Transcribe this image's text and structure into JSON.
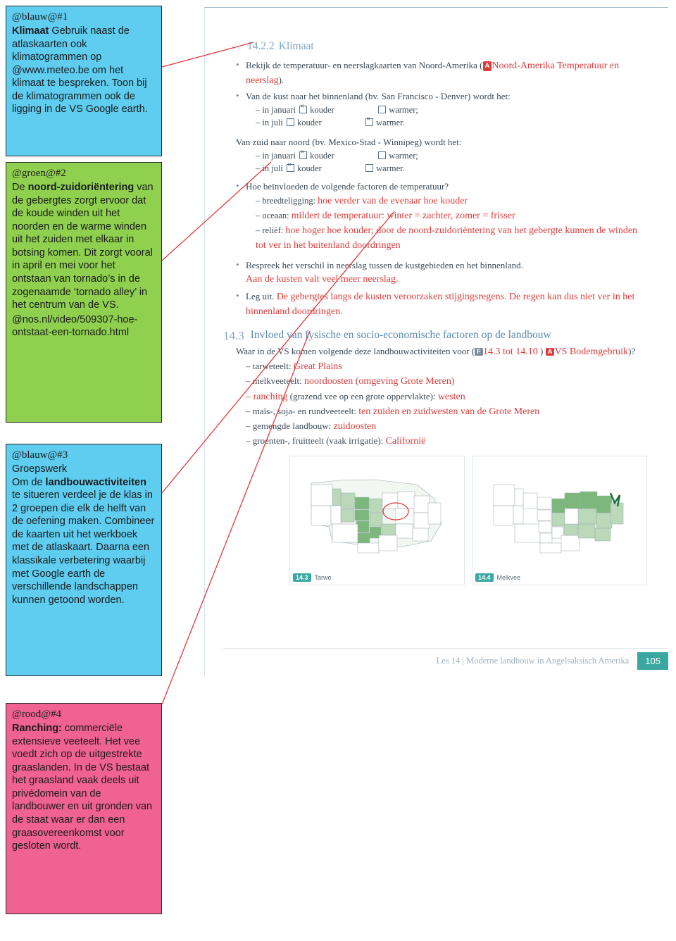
{
  "notes": [
    {
      "id": "note1",
      "tag": "@blauw@#1",
      "color": "#5ecdf0",
      "bold_lead": "Klimaat",
      "text": " Gebruik naast de atlaskaarten ook klimatogrammen op @www.meteo.be om het klimaat te bespreken. Toon bij de klimatogrammen ook de ligging in de VS Google earth."
    },
    {
      "id": "note2",
      "tag": "@groen@#2",
      "color": "#8fd14f",
      "text_before": "De ",
      "bold_lead": "noord-zuidoriëntering",
      "text": " van de gebergtes zorgt ervoor dat de koude winden uit het noorden en de warme winden uit het zuiden met elkaar in botsing komen. Dit zorgt vooral in april en mei voor het ontstaan van tornado’s in de zogenaamde ‘tornado alley’ in het centrum van de VS.",
      "link": "@nos.nl/video/509307-hoe-ontstaat-een-tornado.html"
    },
    {
      "id": "note3",
      "tag": "@blauw@#3",
      "color": "#5ecdf0",
      "title": "Groepswerk",
      "text_before": "Om de ",
      "bold_lead": "landbouwactiviteiten",
      "text": " te situeren verdeel je de klas in 2 groepen die elk de helft van de oefening maken. Combineer de kaarten uit het werkboek met de atlaskaart. Daarna een klassikale verbetering waarbij met Google earth de verschillende landschappen kunnen getoond worden."
    },
    {
      "id": "note4",
      "tag": "@rood@#4",
      "color": "#f06292",
      "bold_lead": "Ranching:",
      "text": " commerciële extensieve veeteelt. Het vee voedt zich op de uitgestrekte graaslanden. In de VS bestaat het graasland vaak deels uit privédomein van de landbouwer en uit gronden van de staat waar er dan een graasovereenkomst voor gesloten wordt."
    }
  ],
  "page": {
    "section_climate": {
      "number": "14.2.2",
      "title": "Klimaat"
    },
    "bullets": [
      {
        "text_before": "Bekijk de temperatuur- en neerslagkaarten van Noord-Amerika (",
        "badge": "A",
        "badge_text": "Noord-Amerika Temperatuur en neerslag",
        "text_after": ")."
      },
      {
        "text": "Van de kust naar het binnenland (bv. San Francisco - Denver) wordt het:",
        "rows": [
          {
            "label": "– in januari",
            "opt1": "kouder",
            "opt1_checked": true,
            "opt2": "warmer;",
            "opt2_checked": false
          },
          {
            "label": "– in juli",
            "opt1": "kouder",
            "opt1_checked": false,
            "opt2": "warmer.",
            "opt2_checked": true
          }
        ]
      },
      {
        "text": "Van zuid naar noord (bv. Mexico-Stad - Winnipeg) wordt het:",
        "rows": [
          {
            "label": "– in januari",
            "opt1": "kouder",
            "opt1_checked": true,
            "opt2": "warmer;",
            "opt2_checked": false
          },
          {
            "label": "– in juli",
            "opt1": "kouder",
            "opt1_checked": true,
            "opt2": "warmer.",
            "opt2_checked": false
          }
        ]
      },
      {
        "text": "Hoe beïnvloeden de volgende factoren de temperatuur?",
        "items": [
          {
            "label": "– breedteligging:",
            "answer": "hoe verder van de evenaar hoe kouder"
          },
          {
            "label": "– oceaan:",
            "answer": "mildert de temperatuur: winter = zachter, zomer = frisser"
          },
          {
            "label": "– reliëf:",
            "answer": "hoe hoger hoe kouder; door de noord-zuidoriëntering van het gebergte kunnen de winden tot ver in het buitenland doordringen"
          }
        ]
      },
      {
        "text": "Bespreek het verschil in neerslag tussen de kustgebieden en het binnenland.",
        "answer": "Aan de kusten valt veel meer neerslag."
      },
      {
        "text": "Leg uit.",
        "answer": "De gebergtes langs de kusten veroorzaken stijgingsregens. De regen kan dus niet ver in het binnenland doordringen."
      }
    ],
    "section_influence": {
      "number": "14.3",
      "title": "Invloed van fysische en socio-economische factoren op de landbouw"
    },
    "question": {
      "text_before": "Waar in de VS komen volgende deze landbouwactiviteiten voor (",
      "badge_f": "F",
      "badge_f_text": "14.3 tot 14.10",
      "badge_a": "A",
      "badge_a_text": "VS Bodemgebruik",
      "text_after": ")?"
    },
    "answers": [
      {
        "label": "– tarweteelt:",
        "answer": "Great Plains"
      },
      {
        "label": "– melkveeteelt:",
        "answer": "noordoosten (omgeving Grote Meren)"
      },
      {
        "label": "– ranching",
        "label2": " (grazend vee op een grote oppervlakte):",
        "answer": "westen"
      },
      {
        "label": "– maïs-, soja- en rundveeteelt:",
        "answer": "ten zuiden en zuidwesten van de Grote Meren"
      },
      {
        "label": "– gemengde landbouw:",
        "answer": "zuidoosten"
      },
      {
        "label": "– groenten-, fruitteelt (vaak irrigatie):",
        "answer": "Californië"
      }
    ],
    "maps": [
      {
        "number": "14.3",
        "caption": "Tarwe"
      },
      {
        "number": "14.4",
        "caption": "Melkvee"
      }
    ],
    "footer": {
      "text": "Les 14 | Moderne landbouw in Angelsaksisch Amerika",
      "page_number": "105"
    }
  }
}
